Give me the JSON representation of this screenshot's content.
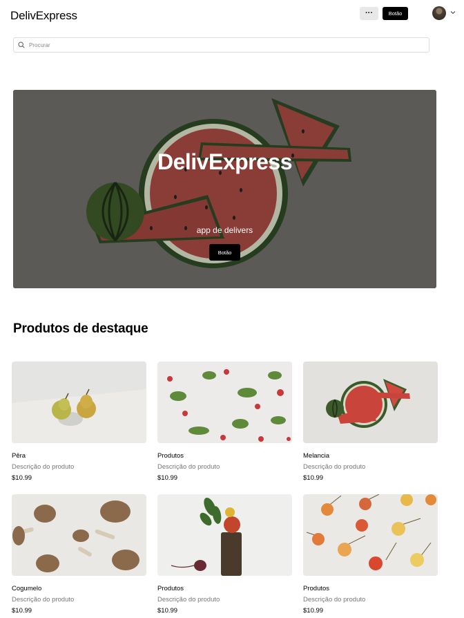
{
  "header": {
    "logo": "DelivExpress",
    "more_label": "···",
    "button_label": "Botão"
  },
  "search": {
    "placeholder": "Procurar"
  },
  "hero": {
    "title": "DelivExpress",
    "subtitle": "app de delivers",
    "button_label": "Botão"
  },
  "section": {
    "title": "Produtos de destaque"
  },
  "products": [
    {
      "name": "Pêra",
      "description": "Descrição do  produto",
      "price": "$10.99",
      "image": "pears"
    },
    {
      "name": "Produtos",
      "description": "Descrição do  produto",
      "price": "$10.99",
      "image": "radishes"
    },
    {
      "name": "Melancia",
      "description": "Descrição do  produto",
      "price": "$10.99",
      "image": "watermelon"
    },
    {
      "name": "Cogumelo",
      "description": "Descrição do  produto",
      "price": "$10.99",
      "image": "mushrooms"
    },
    {
      "name": "Produtos",
      "description": "Descrição do  produto",
      "price": "$10.99",
      "image": "vegetable-stack"
    },
    {
      "name": "Produtos",
      "description": "Descrição do  produto",
      "price": "$10.99",
      "image": "cherries"
    }
  ]
}
